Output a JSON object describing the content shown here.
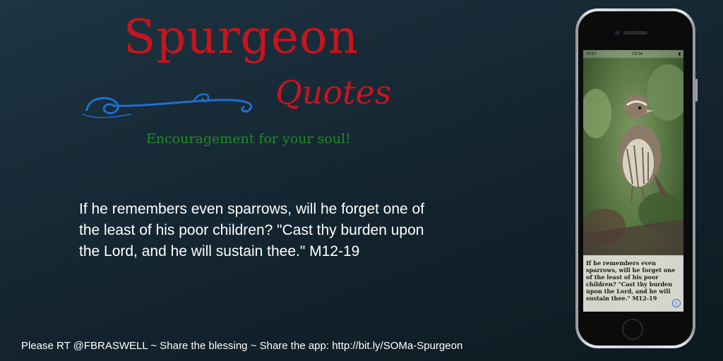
{
  "header": {
    "title": "Spurgeon",
    "subtitle": "Quotes",
    "tagline": "Encouragement for your soul!"
  },
  "quote": {
    "text": "If he remembers even sparrows, will he forget one of the least of his poor children? \"Cast thy burden upon the Lord, and he will sustain thee.\" M12-19"
  },
  "phone": {
    "status": {
      "carrier": "AT&T",
      "time": "03:34",
      "battery": "▮"
    },
    "screen_quote": "If he remembers even sparrows, will he forget one of the least of his poor children? \"Cast thy burden upon the Lord, and he will sustain thee.\" M12-19",
    "info_icon": "i",
    "image_subject": "sparrow on plant"
  },
  "footer": {
    "text": "Please RT @FBRASWELL ~ Share the blessing ~ Share the app: http://bit.ly/SOMa-Spurgeon"
  },
  "colors": {
    "title_red": "#c8141c",
    "tagline_green": "#1f8d1f",
    "swash_blue": "#1f6fd0",
    "background": "#17293a"
  },
  "icons": [
    "swash-ornament",
    "info-icon"
  ]
}
